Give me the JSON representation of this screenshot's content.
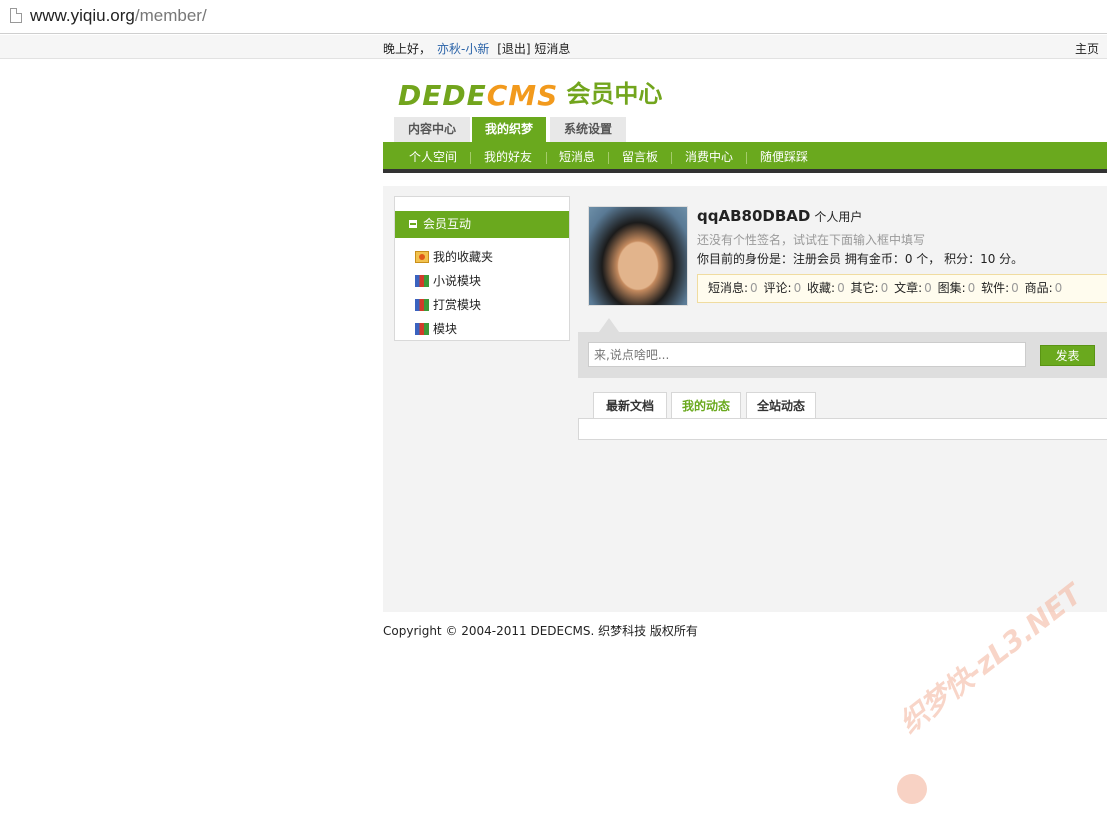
{
  "browser": {
    "url_host": "www.yiqiu.org",
    "url_path": "/member/"
  },
  "topbar": {
    "greeting": "晚上好，",
    "username": "亦秋-小新",
    "logout": "[退出]",
    "messages": "短消息",
    "home": "主页"
  },
  "logo": {
    "part1": "DEDE",
    "part2": "CMS",
    "suffix": "会员中心"
  },
  "main_tabs": [
    {
      "label": "内容中心",
      "active": false
    },
    {
      "label": "我的织梦",
      "active": true
    },
    {
      "label": "系统设置",
      "active": false
    }
  ],
  "sub_nav": [
    "个人空间",
    "我的好友",
    "短消息",
    "留言板",
    "消费中心",
    "随便踩踩"
  ],
  "sidebar": {
    "header": "会员互动",
    "items": [
      {
        "label": "我的收藏夹",
        "icon": "folder-star-icon"
      },
      {
        "label": "小说模块",
        "icon": "books-icon"
      },
      {
        "label": "打赏模块",
        "icon": "books-icon"
      },
      {
        "label": "模块",
        "icon": "books-icon"
      }
    ]
  },
  "profile": {
    "name": "qqAB80DBAD",
    "type": "个人用户",
    "signature": "还没有个性签名，试试在下面输入框中填写",
    "identity": "你目前的身份是：注册会员 拥有金币：0 个， 积分：10 分。"
  },
  "stats": [
    {
      "label": "短消息:",
      "value": "0"
    },
    {
      "label": "评论:",
      "value": "0"
    },
    {
      "label": "收藏:",
      "value": "0"
    },
    {
      "label": "其它:",
      "value": "0"
    },
    {
      "label": "文章:",
      "value": "0"
    },
    {
      "label": "图集:",
      "value": "0"
    },
    {
      "label": "软件:",
      "value": "0"
    },
    {
      "label": "商品:",
      "value": "0"
    }
  ],
  "post": {
    "placeholder": "来,说点啥吧...",
    "button": "发表"
  },
  "feed_tabs": [
    {
      "label": "最新文档",
      "active": false
    },
    {
      "label": "我的动态",
      "active": true
    },
    {
      "label": "全站动态",
      "active": false
    }
  ],
  "footer": "Copyright © 2004-2011 DEDECMS. 织梦科技 版权所有",
  "watermark": "织梦快-zL3.NET",
  "colors": {
    "accent": "#6aa91e",
    "logo_orange": "#f29a1d"
  }
}
